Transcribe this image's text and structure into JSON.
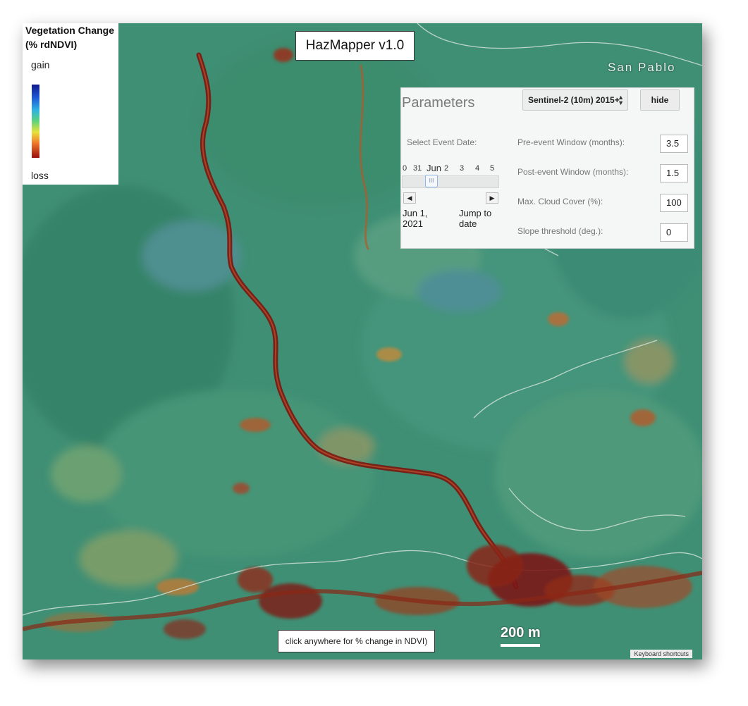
{
  "app": {
    "title": "HazMapper v1.0"
  },
  "legend": {
    "title_line1": "Vegetation Change",
    "title_line2": "(% rdNDVI)",
    "gain_label": "gain",
    "loss_label": "loss",
    "colors": [
      "#101a8a",
      "#1e5ad8",
      "#2fb3e0",
      "#5ed37a",
      "#e8e23a",
      "#f0782a",
      "#9a0d0d"
    ]
  },
  "map": {
    "place_label": "San Pablo",
    "click_hint": "click anywhere for % change in NDVI)",
    "scale_label": "200 m",
    "keyboard_shortcuts": "Keyboard shortcuts",
    "colors": {
      "vegetation": "#3e8f74",
      "change_red": "#8f1c12",
      "change_orange": "#c86a2c"
    }
  },
  "parameters": {
    "title": "Parameters",
    "sensor_select": "Sentinel-2 (10m) 2015+",
    "hide_label": "hide",
    "select_event_date_label": "Select Event Date:",
    "date_slider": {
      "ticks": [
        "0",
        "31",
        "Jun",
        "2",
        "3",
        "4",
        "5"
      ],
      "thumb_glyph": "III",
      "prev_icon": "◀",
      "next_icon": "▶",
      "selected_date_line1": "Jun 1,",
      "selected_date_line2": "2021",
      "jump_line1": "Jump to",
      "jump_line2": "date"
    },
    "fields": [
      {
        "label": "Pre-event Window (months):",
        "value": "3.5"
      },
      {
        "label": "Post-event Window (months):",
        "value": "1.5"
      },
      {
        "label": "Max. Cloud Cover (%):",
        "value": "100"
      },
      {
        "label": "Slope threshold (deg.):",
        "value": "0"
      }
    ]
  }
}
